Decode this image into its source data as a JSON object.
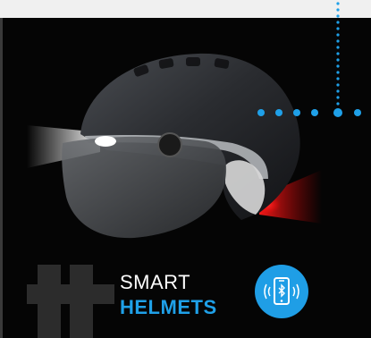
{
  "caption": {
    "line1": "SMART",
    "line2": "HELMETS"
  },
  "colors": {
    "background": "#050505",
    "accent": "#1f9ee6",
    "tail_light": "#e0141a",
    "head_light": "#f4f4f4",
    "hash_mark": "#2c2c2c"
  },
  "icons": {
    "badge": "bluetooth-phone-icon"
  }
}
